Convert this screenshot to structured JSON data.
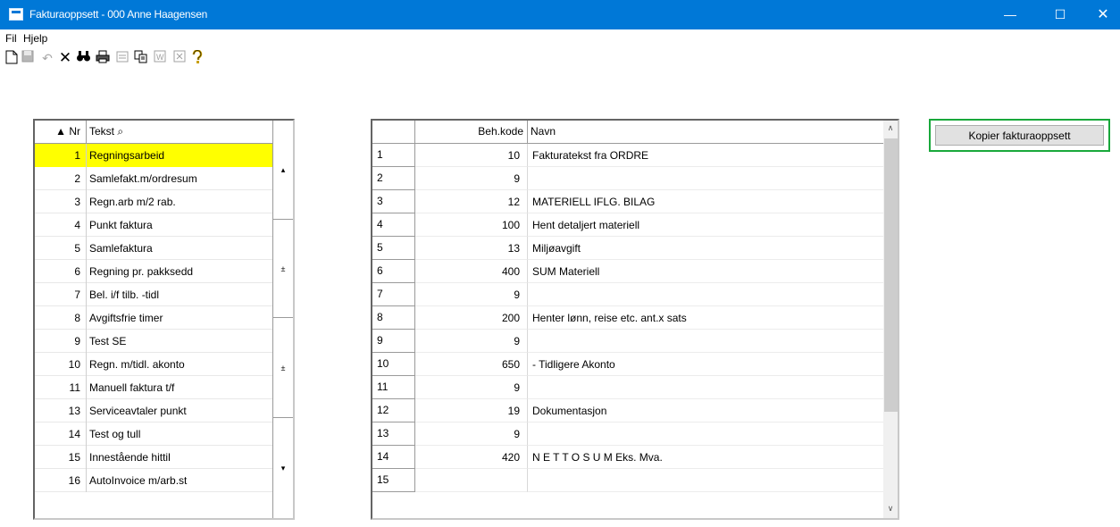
{
  "window": {
    "title": "Fakturaoppsett - 000 Anne Haagensen",
    "minimize": "—",
    "maximize": "☐",
    "close": "✕"
  },
  "menu": {
    "fil": "Fil",
    "hjelp": "Hjelp"
  },
  "toolbar": {
    "icons": [
      "new-document-icon",
      "save-icon",
      "undo-icon",
      "delete-icon",
      "find-icon",
      "print-icon",
      "form-icon",
      "copy-icon",
      "word-icon",
      "excel-icon",
      "help-icon"
    ]
  },
  "left_table": {
    "headers": {
      "nr": "▲ Nr",
      "tekst": "Tekst ⌕"
    },
    "rows": [
      {
        "nr": "1",
        "tekst": "Regningsarbeid",
        "selected": true
      },
      {
        "nr": "2",
        "tekst": "Samlefakt.m/ordresum"
      },
      {
        "nr": "3",
        "tekst": "Regn.arb m/2 rab."
      },
      {
        "nr": "4",
        "tekst": "Punkt faktura"
      },
      {
        "nr": "5",
        "tekst": "Samlefaktura"
      },
      {
        "nr": "6",
        "tekst": "Regning pr. pakksedd"
      },
      {
        "nr": "7",
        "tekst": "Bel. i/f tilb. -tidl"
      },
      {
        "nr": "8",
        "tekst": "Avgiftsfrie timer"
      },
      {
        "nr": "9",
        "tekst": "Test SE"
      },
      {
        "nr": "10",
        "tekst": "Regn. m/tidl. akonto"
      },
      {
        "nr": "11",
        "tekst": "Manuell faktura t/f"
      },
      {
        "nr": "13",
        "tekst": "Serviceavtaler punkt"
      },
      {
        "nr": "14",
        "tekst": "Test og tull"
      },
      {
        "nr": "15",
        "tekst": "Innestående hittil"
      },
      {
        "nr": "16",
        "tekst": "AutoInvoice m/arb.st"
      }
    ],
    "scroll_glyphs": {
      "top": "▴",
      "page_up": "±",
      "page_down": "±",
      "bottom": "▾"
    }
  },
  "right_table": {
    "headers": {
      "beh": "Beh.kode",
      "navn": "Navn"
    },
    "rows": [
      {
        "idx": "1",
        "beh": "10",
        "navn": "Fakturatekst fra ORDRE"
      },
      {
        "idx": "2",
        "beh": "9",
        "navn": ""
      },
      {
        "idx": "3",
        "beh": "12",
        "navn": "MATERIELL IFLG. BILAG"
      },
      {
        "idx": "4",
        "beh": "100",
        "navn": "Hent detaljert materiell"
      },
      {
        "idx": "5",
        "beh": "13",
        "navn": "Miljøavgift"
      },
      {
        "idx": "6",
        "beh": "400",
        "navn": "SUM  Materiell"
      },
      {
        "idx": "7",
        "beh": "9",
        "navn": ""
      },
      {
        "idx": "8",
        "beh": "200",
        "navn": "Henter lønn, reise etc. ant.x sats"
      },
      {
        "idx": "9",
        "beh": "9",
        "navn": ""
      },
      {
        "idx": "10",
        "beh": "650",
        "navn": "- Tidligere Akonto"
      },
      {
        "idx": "11",
        "beh": "9",
        "navn": ""
      },
      {
        "idx": "12",
        "beh": "19",
        "navn": "Dokumentasjon"
      },
      {
        "idx": "13",
        "beh": "9",
        "navn": ""
      },
      {
        "idx": "14",
        "beh": "420",
        "navn": "N E T T O S U M  Eks. Mva."
      },
      {
        "idx": "15",
        "beh": "",
        "navn": ""
      }
    ],
    "scroll_up": "∧",
    "scroll_down": "∨"
  },
  "copy_button_label": "Kopier fakturaoppsett"
}
